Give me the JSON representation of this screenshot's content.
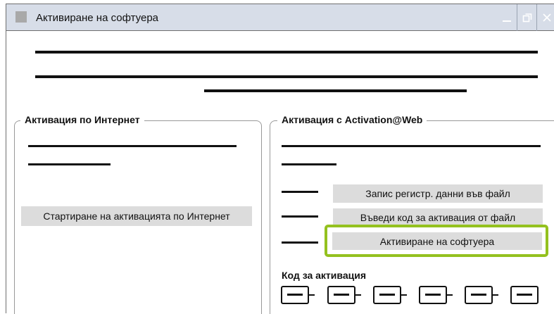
{
  "window": {
    "title": "Активиране на софтуера",
    "controls": [
      "minimize-icon",
      "restore-icon",
      "close-icon"
    ]
  },
  "internet_group": {
    "legend": "Активация по Интернет",
    "start_button": "Стартиране на активацията по Интернет"
  },
  "web_group": {
    "legend": "Активация с Activation@Web",
    "save_button": "Запис регистр. данни във файл",
    "load_code_button": "Въведи код за активация от файл",
    "activate_button": "Активиране на софтуера",
    "code_label": "Код за активация",
    "code_segment_count": 6
  },
  "colors": {
    "titlebar": "#d7dde8",
    "button": "#dcdcdc",
    "highlight": "#94c11f"
  }
}
